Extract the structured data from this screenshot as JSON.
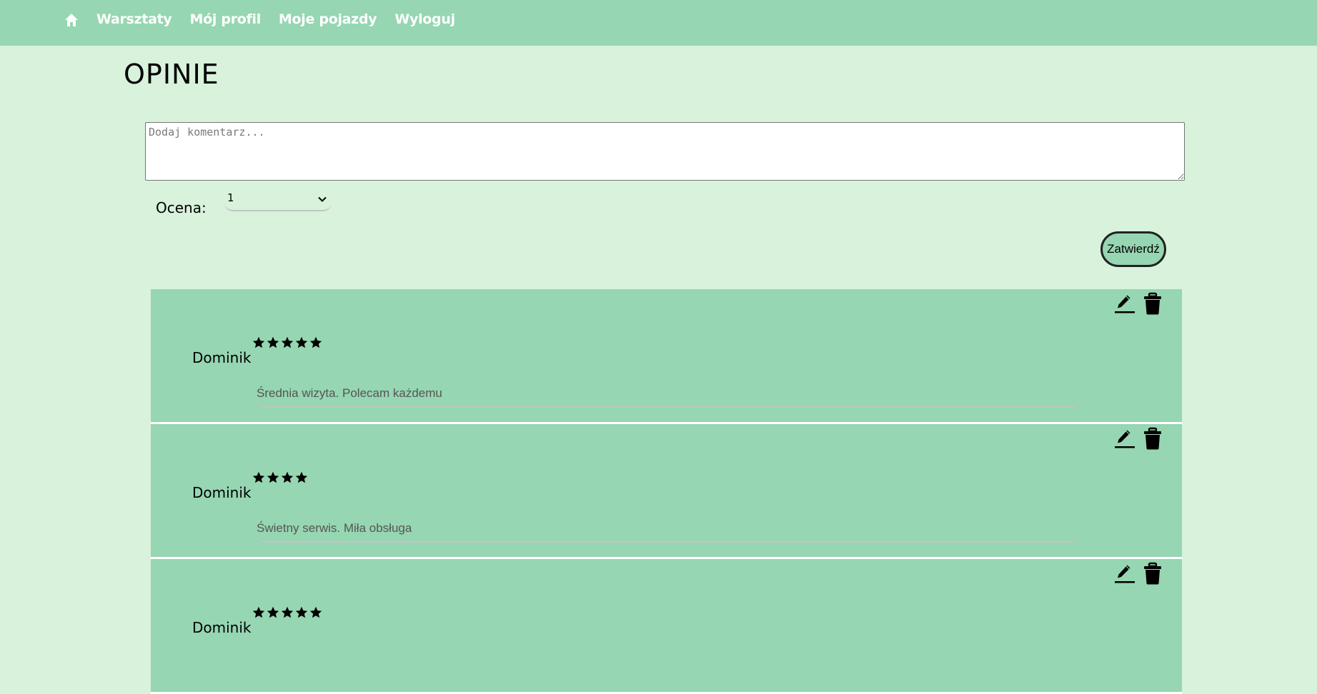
{
  "nav": {
    "home_icon": "home-icon",
    "links": [
      "Warsztaty",
      "Mój profil",
      "Moje pojazdy",
      "Wyloguj"
    ]
  },
  "page": {
    "title": "OPINIE"
  },
  "form": {
    "comment_placeholder": "Dodaj komentarz...",
    "comment_value": "",
    "rating_label": "Ocena:",
    "rating_value": "1",
    "submit_label": "Zatwierdź"
  },
  "reviews": [
    {
      "author": "Dominik",
      "rating": 5,
      "text": "Średnia wizyta. Polecam każdemu"
    },
    {
      "author": "Dominik",
      "rating": 4,
      "text": "Świetny serwis. Miła obsługa"
    },
    {
      "author": "Dominik",
      "rating": 5,
      "text": ""
    }
  ],
  "icons": {
    "edit": "pencil-icon",
    "delete": "trash-icon",
    "star": "star-icon"
  },
  "colors": {
    "navbar": "#96d6b2",
    "background": "#d8f2dc",
    "card": "#96d6b2",
    "nav_text": "#ffffff"
  }
}
